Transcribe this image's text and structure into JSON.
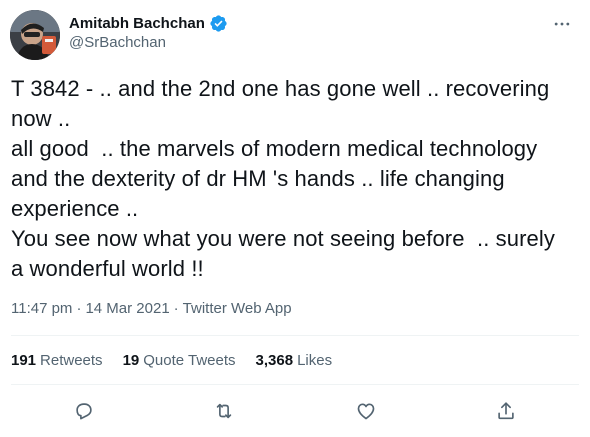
{
  "author": {
    "display_name": "Amitabh Bachchan",
    "handle": "@SrBachchan",
    "verified": true
  },
  "tweet": {
    "text": "T 3842 - .. and the 2nd one has gone well .. recovering now ..\nall good  .. the marvels of modern medical technology and the dexterity of dr HM 's hands .. life changing experience ..\nYou see now what you were not seeing before  .. surely a wonderful world !!",
    "time": "11:47 pm",
    "date": "14 Mar 2021",
    "separator": "·",
    "source": "Twitter Web App"
  },
  "stats": {
    "retweets_count": "191",
    "retweets_label": "Retweets",
    "quote_count": "19",
    "quote_label": "Quote Tweets",
    "likes_count": "3,368",
    "likes_label": "Likes"
  },
  "icons": {
    "more": "more-horizontal-icon",
    "verified": "verified-badge-icon",
    "reply": "reply-icon",
    "retweet": "retweet-icon",
    "like": "heart-icon",
    "share": "share-icon"
  },
  "colors": {
    "text_primary": "#0f1419",
    "text_secondary": "#536471",
    "verified_blue": "#1d9bf0",
    "divider": "#eff3f4"
  }
}
